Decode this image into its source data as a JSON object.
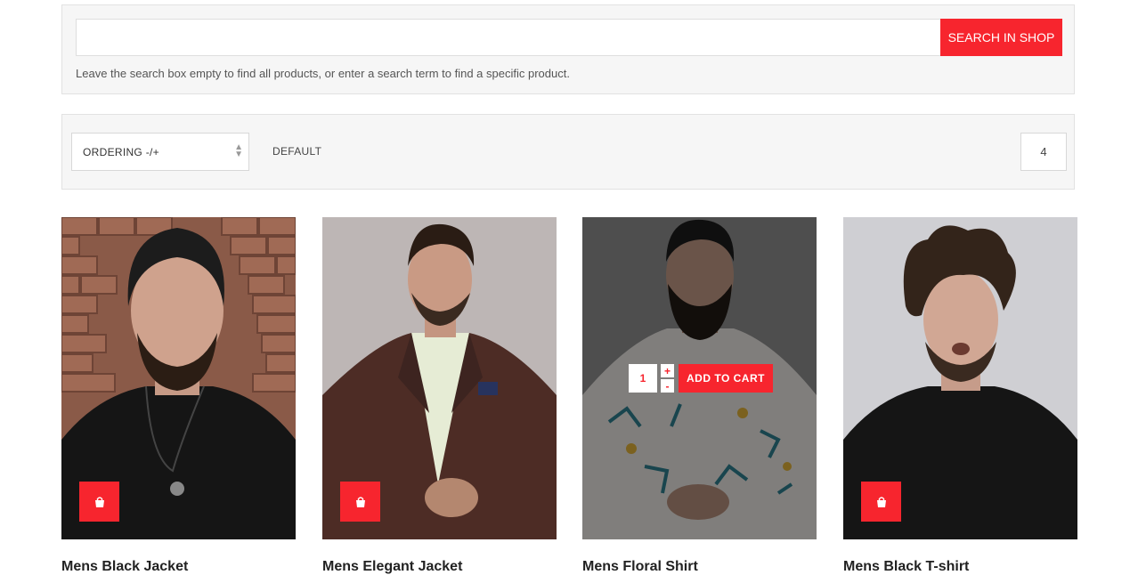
{
  "search": {
    "value": "",
    "placeholder": "",
    "button_label": "SEARCH IN SHOP",
    "hint": "Leave the search box empty to find all products, or enter a search term to find a specific product."
  },
  "ordering": {
    "select_label": "ORDERING -/+",
    "default_label": "DEFAULT",
    "limit_value": "4"
  },
  "products": [
    {
      "title": "Mens Black Jacket",
      "icon": "shopping-bag-icon"
    },
    {
      "title": "Mens Elegant Jacket",
      "icon": "shopping-bag-icon"
    },
    {
      "title": "Mens Floral Shirt",
      "quantity": "1",
      "plus": "+",
      "minus": "-",
      "add_to_cart": "ADD TO CART"
    },
    {
      "title": "Mens Black T-shirt",
      "icon": "shopping-bag-icon"
    }
  ],
  "colors": {
    "accent": "#f7252e",
    "panel_bg": "#f6f6f6"
  }
}
